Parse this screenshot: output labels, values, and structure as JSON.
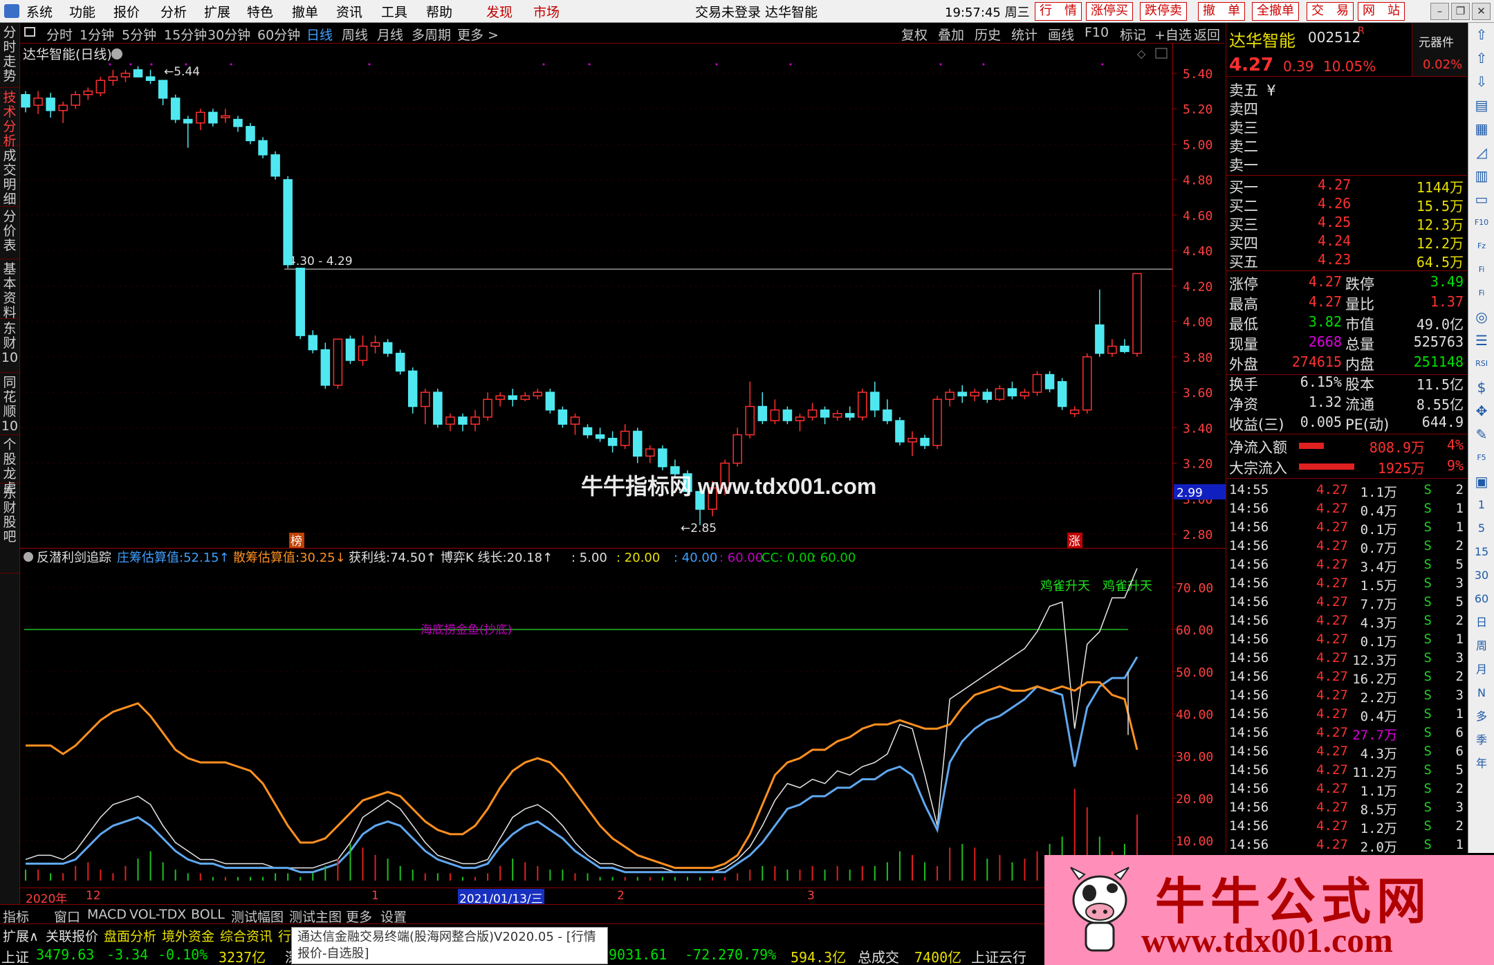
{
  "menubar": {
    "items": [
      "系统",
      "功能",
      "报价",
      "分析",
      "扩展",
      "特色",
      "撤单",
      "资讯",
      "工具",
      "帮助"
    ],
    "red_items": [
      "发现",
      "市场"
    ],
    "clock": "19:57:45 周三",
    "title": "交易未登录 达华智能",
    "buttons": [
      "行　情",
      "涨停买",
      "跌停卖",
      "撤　单",
      "全撤单",
      "交　易",
      "网　站"
    ]
  },
  "left_tabs": [
    "分时走势",
    "技术分析",
    "成交明细",
    "分价表",
    "基本资料",
    "东财10",
    "同花顺10",
    "个股龙虎",
    "东财股吧"
  ],
  "period_bar": {
    "items": [
      "分时",
      "1分钟",
      "5分钟",
      "15分钟",
      "30分钟",
      "60分钟",
      "日线",
      "周线",
      "月线",
      "多周期",
      "更多 >"
    ],
    "active": "日线",
    "right_items": [
      "复权",
      "叠加",
      "历史",
      "统计",
      "画线",
      "F10",
      "标记",
      "+自选",
      "返回"
    ]
  },
  "main_chart": {
    "title": "达华智能(日线)",
    "hline_label": "4.30 - 4.29",
    "high_label": "5.44",
    "low_label": "2.85",
    "price_ticks": [
      "5.40",
      "5.20",
      "5.00",
      "4.80",
      "4.60",
      "4.40",
      "4.20",
      "4.00",
      "3.80",
      "3.60",
      "3.40",
      "3.20",
      "3.00",
      "2.80"
    ],
    "cursor_price": "2.99",
    "markers": [
      "榜",
      "涨"
    ]
  },
  "indicator": {
    "name": "反潜利剑追踪",
    "items": [
      {
        "k": "庄筹估算值:",
        "v": "52.15↑"
      },
      {
        "k": "散筹估算值:",
        "v": "30.25↓"
      },
      {
        "k": "获利线:",
        "v": "74.50↑"
      },
      {
        "k": "博弈K 线长:",
        "v": "20.18↑"
      }
    ],
    "levels": [
      ": 5.00",
      ": 20.00",
      ": 40.00",
      ": 60.00",
      "CC: 0.00",
      ": 60.00"
    ],
    "ticks": [
      "70.00",
      "60.00",
      "50.00",
      "40.00",
      "30.00",
      "20.00",
      "10.00"
    ],
    "label_sea": "海底捞金鱼(抄底)",
    "label_sky": "鸡雀升天"
  },
  "chart_data": {
    "type": "candlestick",
    "title": "达华智能(日线)",
    "ylim": [
      2.75,
      5.5
    ],
    "series": [
      {
        "o": 5.28,
        "h": 5.3,
        "l": 5.18,
        "c": 5.21
      },
      {
        "o": 5.22,
        "h": 5.3,
        "l": 5.17,
        "c": 5.26
      },
      {
        "o": 5.26,
        "h": 5.29,
        "l": 5.15,
        "c": 5.19
      },
      {
        "o": 5.19,
        "h": 5.24,
        "l": 5.12,
        "c": 5.22
      },
      {
        "o": 5.22,
        "h": 5.3,
        "l": 5.2,
        "c": 5.28
      },
      {
        "o": 5.28,
        "h": 5.32,
        "l": 5.25,
        "c": 5.3
      },
      {
        "o": 5.29,
        "h": 5.38,
        "l": 5.27,
        "c": 5.36
      },
      {
        "o": 5.36,
        "h": 5.42,
        "l": 5.33,
        "c": 5.38
      },
      {
        "o": 5.38,
        "h": 5.42,
        "l": 5.35,
        "c": 5.4
      },
      {
        "o": 5.42,
        "h": 5.44,
        "l": 5.38,
        "c": 5.38
      },
      {
        "o": 5.38,
        "h": 5.42,
        "l": 5.34,
        "c": 5.36
      },
      {
        "o": 5.36,
        "h": 5.36,
        "l": 5.22,
        "c": 5.26
      },
      {
        "o": 5.26,
        "h": 5.28,
        "l": 5.12,
        "c": 5.14
      },
      {
        "o": 5.14,
        "h": 5.16,
        "l": 4.98,
        "c": 5.12
      },
      {
        "o": 5.12,
        "h": 5.2,
        "l": 5.08,
        "c": 5.18
      },
      {
        "o": 5.18,
        "h": 5.2,
        "l": 5.1,
        "c": 5.12
      },
      {
        "o": 5.15,
        "h": 5.2,
        "l": 5.12,
        "c": 5.16
      },
      {
        "o": 5.14,
        "h": 5.16,
        "l": 5.07,
        "c": 5.1
      },
      {
        "o": 5.1,
        "h": 5.12,
        "l": 5.0,
        "c": 5.02
      },
      {
        "o": 5.02,
        "h": 5.04,
        "l": 4.92,
        "c": 4.94
      },
      {
        "o": 4.94,
        "h": 4.96,
        "l": 4.8,
        "c": 4.82
      },
      {
        "o": 4.8,
        "h": 4.82,
        "l": 4.3,
        "c": 4.32
      },
      {
        "o": 4.3,
        "h": 4.3,
        "l": 3.9,
        "c": 3.92
      },
      {
        "o": 3.92,
        "h": 3.95,
        "l": 3.82,
        "c": 3.84
      },
      {
        "o": 3.84,
        "h": 3.88,
        "l": 3.62,
        "c": 3.64
      },
      {
        "o": 3.64,
        "h": 3.84,
        "l": 3.62,
        "c": 3.9
      },
      {
        "o": 3.9,
        "h": 3.92,
        "l": 3.76,
        "c": 3.78
      },
      {
        "o": 3.78,
        "h": 3.92,
        "l": 3.75,
        "c": 3.86
      },
      {
        "o": 3.86,
        "h": 3.92,
        "l": 3.82,
        "c": 3.88
      },
      {
        "o": 3.88,
        "h": 3.9,
        "l": 3.8,
        "c": 3.82
      },
      {
        "o": 3.82,
        "h": 3.84,
        "l": 3.7,
        "c": 3.72
      },
      {
        "o": 3.72,
        "h": 3.74,
        "l": 3.48,
        "c": 3.52
      },
      {
        "o": 3.52,
        "h": 3.62,
        "l": 3.42,
        "c": 3.6
      },
      {
        "o": 3.6,
        "h": 3.62,
        "l": 3.4,
        "c": 3.42
      },
      {
        "o": 3.42,
        "h": 3.48,
        "l": 3.38,
        "c": 3.46
      },
      {
        "o": 3.46,
        "h": 3.48,
        "l": 3.38,
        "c": 3.42
      },
      {
        "o": 3.42,
        "h": 3.5,
        "l": 3.38,
        "c": 3.46
      },
      {
        "o": 3.46,
        "h": 3.6,
        "l": 3.44,
        "c": 3.56
      },
      {
        "o": 3.56,
        "h": 3.6,
        "l": 3.52,
        "c": 3.58
      },
      {
        "o": 3.58,
        "h": 3.62,
        "l": 3.52,
        "c": 3.56
      },
      {
        "o": 3.56,
        "h": 3.6,
        "l": 3.55,
        "c": 3.58
      },
      {
        "o": 3.58,
        "h": 3.62,
        "l": 3.56,
        "c": 3.6
      },
      {
        "o": 3.6,
        "h": 3.62,
        "l": 3.48,
        "c": 3.5
      },
      {
        "o": 3.5,
        "h": 3.52,
        "l": 3.4,
        "c": 3.42
      },
      {
        "o": 3.42,
        "h": 3.48,
        "l": 3.36,
        "c": 3.46
      },
      {
        "o": 3.4,
        "h": 3.42,
        "l": 3.34,
        "c": 3.36
      },
      {
        "o": 3.36,
        "h": 3.4,
        "l": 3.32,
        "c": 3.34
      },
      {
        "o": 3.34,
        "h": 3.38,
        "l": 3.26,
        "c": 3.3
      },
      {
        "o": 3.3,
        "h": 3.42,
        "l": 3.28,
        "c": 3.38
      },
      {
        "o": 3.38,
        "h": 3.4,
        "l": 3.2,
        "c": 3.24
      },
      {
        "o": 3.24,
        "h": 3.3,
        "l": 3.2,
        "c": 3.28
      },
      {
        "o": 3.28,
        "h": 3.3,
        "l": 3.16,
        "c": 3.18
      },
      {
        "o": 3.18,
        "h": 3.22,
        "l": 3.12,
        "c": 3.14
      },
      {
        "o": 3.14,
        "h": 3.16,
        "l": 3.02,
        "c": 3.04
      },
      {
        "o": 3.04,
        "h": 3.06,
        "l": 2.85,
        "c": 2.94
      },
      {
        "o": 2.94,
        "h": 3.1,
        "l": 2.9,
        "c": 3.06
      },
      {
        "o": 3.06,
        "h": 3.22,
        "l": 3.02,
        "c": 3.2
      },
      {
        "o": 3.2,
        "h": 3.4,
        "l": 3.18,
        "c": 3.36
      },
      {
        "o": 3.36,
        "h": 3.66,
        "l": 3.34,
        "c": 3.52
      },
      {
        "o": 3.52,
        "h": 3.6,
        "l": 3.42,
        "c": 3.44
      },
      {
        "o": 3.44,
        "h": 3.56,
        "l": 3.42,
        "c": 3.5
      },
      {
        "o": 3.5,
        "h": 3.52,
        "l": 3.42,
        "c": 3.44
      },
      {
        "o": 3.44,
        "h": 3.48,
        "l": 3.38,
        "c": 3.46
      },
      {
        "o": 3.46,
        "h": 3.54,
        "l": 3.44,
        "c": 3.5
      },
      {
        "o": 3.5,
        "h": 3.52,
        "l": 3.42,
        "c": 3.46
      },
      {
        "o": 3.46,
        "h": 3.5,
        "l": 3.44,
        "c": 3.48
      },
      {
        "o": 3.48,
        "h": 3.52,
        "l": 3.44,
        "c": 3.46
      },
      {
        "o": 3.46,
        "h": 3.62,
        "l": 3.44,
        "c": 3.6
      },
      {
        "o": 3.6,
        "h": 3.66,
        "l": 3.46,
        "c": 3.5
      },
      {
        "o": 3.5,
        "h": 3.56,
        "l": 3.42,
        "c": 3.44
      },
      {
        "o": 3.44,
        "h": 3.46,
        "l": 3.3,
        "c": 3.32
      },
      {
        "o": 3.32,
        "h": 3.38,
        "l": 3.24,
        "c": 3.34
      },
      {
        "o": 3.34,
        "h": 3.36,
        "l": 3.28,
        "c": 3.3
      },
      {
        "o": 3.3,
        "h": 3.58,
        "l": 3.28,
        "c": 3.56
      },
      {
        "o": 3.56,
        "h": 3.62,
        "l": 3.52,
        "c": 3.6
      },
      {
        "o": 3.6,
        "h": 3.64,
        "l": 3.54,
        "c": 3.58
      },
      {
        "o": 3.58,
        "h": 3.62,
        "l": 3.55,
        "c": 3.6
      },
      {
        "o": 3.6,
        "h": 3.62,
        "l": 3.54,
        "c": 3.56
      },
      {
        "o": 3.56,
        "h": 3.64,
        "l": 3.55,
        "c": 3.62
      },
      {
        "o": 3.62,
        "h": 3.66,
        "l": 3.56,
        "c": 3.58
      },
      {
        "o": 3.58,
        "h": 3.62,
        "l": 3.56,
        "c": 3.6
      },
      {
        "o": 3.6,
        "h": 3.72,
        "l": 3.58,
        "c": 3.7
      },
      {
        "o": 3.7,
        "h": 3.72,
        "l": 3.6,
        "c": 3.62
      },
      {
        "o": 3.66,
        "h": 3.68,
        "l": 3.5,
        "c": 3.52
      },
      {
        "o": 3.48,
        "h": 3.52,
        "l": 3.46,
        "c": 3.5
      },
      {
        "o": 3.5,
        "h": 3.82,
        "l": 3.48,
        "c": 3.8
      },
      {
        "o": 3.98,
        "h": 4.18,
        "l": 3.8,
        "c": 3.82
      },
      {
        "o": 3.82,
        "h": 3.9,
        "l": 3.8,
        "c": 3.86
      },
      {
        "o": 3.86,
        "h": 3.9,
        "l": 3.82,
        "c": 3.83
      },
      {
        "o": 3.82,
        "h": 4.27,
        "l": 3.8,
        "c": 4.27
      }
    ]
  },
  "right_panel": {
    "stock_name": "达华智能",
    "stock_code": "002512",
    "stock_flag": "R",
    "price": "4.27",
    "change": "0.39",
    "pct": "10.05%",
    "tool_label": "元器件",
    "tool_pct": "0.02%",
    "sells": [
      "卖五 ¥",
      "卖四",
      "卖三",
      "卖二",
      "卖一"
    ],
    "buys": [
      {
        "l": "买一",
        "p": "4.27",
        "v": "1144万"
      },
      {
        "l": "买二",
        "p": "4.26",
        "v": "15.5万"
      },
      {
        "l": "买三",
        "p": "4.25",
        "v": "12.3万"
      },
      {
        "l": "买四",
        "p": "4.24",
        "v": "12.2万"
      },
      {
        "l": "买五",
        "p": "4.23",
        "v": "64.5万"
      }
    ],
    "stats": [
      {
        "a": "涨停",
        "av": "4.27",
        "ac": "#ff3030",
        "b": "跌停",
        "bv": "3.49",
        "bc": "#00e000"
      },
      {
        "a": "最高",
        "av": "4.27",
        "ac": "#ff3030",
        "b": "量比",
        "bv": "1.37",
        "bc": "#ff3030"
      },
      {
        "a": "最低",
        "av": "3.82",
        "ac": "#00e000",
        "b": "市值",
        "bv": "49.0亿",
        "bc": "#e0e0e0"
      },
      {
        "a": "现量",
        "av": "2668",
        "ac": "#e000e0",
        "b": "总量",
        "bv": "525763",
        "bc": "#e0e0e0"
      },
      {
        "a": "外盘",
        "av": "274615",
        "ac": "#ff3030",
        "b": "内盘",
        "bv": "251148",
        "bc": "#00e000"
      },
      {
        "a": "换手",
        "av": "6.15%",
        "ac": "#e0e0e0",
        "b": "股本",
        "bv": "11.5亿",
        "bc": "#e0e0e0"
      },
      {
        "a": "净资",
        "av": "1.32",
        "ac": "#e0e0e0",
        "b": "流通",
        "bv": "8.55亿",
        "bc": "#e0e0e0"
      },
      {
        "a": "收益(三)",
        "av": "0.005",
        "ac": "#e0e0e0",
        "b": "PE(动)",
        "bv": "644.9",
        "bc": "#e0e0e0"
      }
    ],
    "flows": [
      {
        "l": "净流入额",
        "v": "808.9万",
        "p": "4%",
        "bar": 0.36
      },
      {
        "l": "大宗流入",
        "v": "1925万",
        "p": "9%",
        "bar": 0.8
      }
    ],
    "ticks": [
      {
        "t": "14:55",
        "p": "4.27",
        "v": "1.1万",
        "c": "#e0e0e0",
        "n": "2"
      },
      {
        "t": "14:56",
        "p": "4.27",
        "v": "0.4万",
        "c": "#e0e0e0",
        "n": "1"
      },
      {
        "t": "14:56",
        "p": "4.27",
        "v": "0.1万",
        "c": "#e0e0e0",
        "n": "1"
      },
      {
        "t": "14:56",
        "p": "4.27",
        "v": "0.7万",
        "c": "#e0e0e0",
        "n": "2"
      },
      {
        "t": "14:56",
        "p": "4.27",
        "v": "3.4万",
        "c": "#e0e0e0",
        "n": "5"
      },
      {
        "t": "14:56",
        "p": "4.27",
        "v": "1.5万",
        "c": "#e0e0e0",
        "n": "3"
      },
      {
        "t": "14:56",
        "p": "4.27",
        "v": "7.7万",
        "c": "#e0e0e0",
        "n": "5"
      },
      {
        "t": "14:56",
        "p": "4.27",
        "v": "4.3万",
        "c": "#e0e0e0",
        "n": "2"
      },
      {
        "t": "14:56",
        "p": "4.27",
        "v": "0.1万",
        "c": "#e0e0e0",
        "n": "1"
      },
      {
        "t": "14:56",
        "p": "4.27",
        "v": "12.3万",
        "c": "#e0e0e0",
        "n": "3"
      },
      {
        "t": "14:56",
        "p": "4.27",
        "v": "16.2万",
        "c": "#e0e0e0",
        "n": "2"
      },
      {
        "t": "14:56",
        "p": "4.27",
        "v": "2.2万",
        "c": "#e0e0e0",
        "n": "3"
      },
      {
        "t": "14:56",
        "p": "4.27",
        "v": "0.4万",
        "c": "#e0e0e0",
        "n": "1"
      },
      {
        "t": "14:56",
        "p": "4.27",
        "v": "27.7万",
        "c": "#e000e0",
        "n": "6"
      },
      {
        "t": "14:56",
        "p": "4.27",
        "v": "4.3万",
        "c": "#e0e0e0",
        "n": "6"
      },
      {
        "t": "14:56",
        "p": "4.27",
        "v": "11.2万",
        "c": "#e0e0e0",
        "n": "5"
      },
      {
        "t": "14:56",
        "p": "4.27",
        "v": "1.1万",
        "c": "#e0e0e0",
        "n": "2"
      },
      {
        "t": "14:56",
        "p": "4.27",
        "v": "8.5万",
        "c": "#e0e0e0",
        "n": "3"
      },
      {
        "t": "14:56",
        "p": "4.27",
        "v": "1.2万",
        "c": "#e0e0e0",
        "n": "2"
      },
      {
        "t": "14:56",
        "p": "4.27",
        "v": "2.0万",
        "c": "#e0e0e0",
        "n": "1"
      }
    ]
  },
  "icons": [
    "up-icon",
    "up-icon",
    "down-icon",
    "chart-icon",
    "grid-icon",
    "line-icon",
    "candle-icon",
    "doc-icon",
    "f10-icon",
    "fin-icon",
    "cap-icon",
    "cap-icon",
    "circle-icon",
    "list-icon",
    "rsi-icon",
    "money-icon",
    "move-icon",
    "pen-icon",
    "f5-icon",
    "img-icon",
    "1",
    "5",
    "15",
    "30",
    "60",
    "日",
    "周",
    "月",
    "N",
    "多",
    "季",
    "年"
  ],
  "x_axis": {
    "items": [
      "2020年",
      "12",
      "1",
      "2021/01/13/三",
      "2",
      "3"
    ]
  },
  "bottom_tabs": [
    "指标",
    "窗口",
    "MACD",
    "VOL-TDX",
    "BOLL",
    "测试幅图",
    "测试主图",
    "更多",
    "设置"
  ],
  "bottom_tabs2": [
    "扩展∧",
    "关联报价",
    "盘面分析",
    "境外资金",
    "综合资讯",
    "行"
  ],
  "bottom_tabs2_colors": [
    "#e0e0e0",
    "#e0e0e0",
    "#e8e000",
    "#e8e000",
    "#e8e000",
    "#e8e000"
  ],
  "index_bar": [
    {
      "t": "上证",
      "c": "#e0e0e0"
    },
    {
      "t": "3479.63",
      "c": "#00e000"
    },
    {
      "t": "-3.34",
      "c": "#00e000"
    },
    {
      "t": "-0.10%",
      "c": "#00e000"
    },
    {
      "t": "3237亿",
      "c": "#e8e000"
    },
    {
      "t": "深",
      "c": "#e0e0e0"
    },
    {
      "t": "9031.61",
      "c": "#00e000"
    },
    {
      "t": "-72.27",
      "c": "#00e000"
    },
    {
      "t": "-0.79%",
      "c": "#00e000"
    },
    {
      "t": "594.3亿",
      "c": "#e8e000"
    },
    {
      "t": "总成交",
      "c": "#e0e0e0"
    },
    {
      "t": "7400亿",
      "c": "#e8e000"
    },
    {
      "t": "上证云行情:",
      "c": "#e0e0e0"
    }
  ],
  "tooltip": "通达信金融交易终端(股海网整合版)V2020.05 - [行情报价-自选股]",
  "watermark": "牛牛指标网 www.tdx001.com",
  "ad": {
    "title": "牛牛公式网",
    "url": "www.tdx001.com"
  }
}
